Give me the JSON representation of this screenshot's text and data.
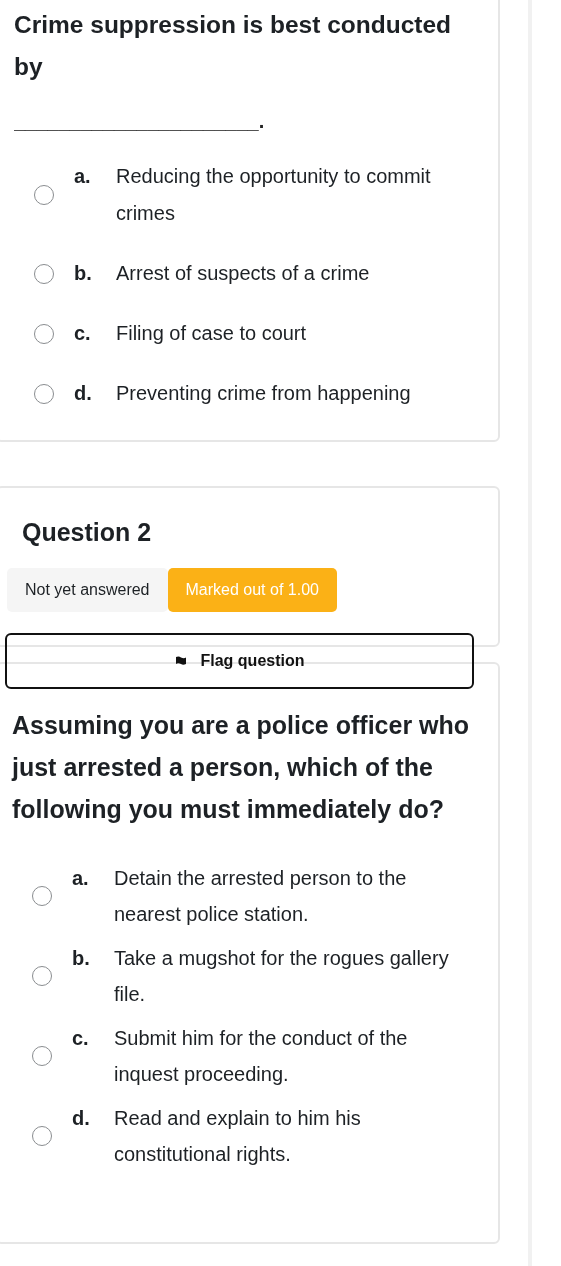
{
  "question_1": {
    "text": "Crime suppression is best conducted by",
    "blank": "______________________.",
    "options": [
      {
        "letter": "a.",
        "text": "Reducing the opportunity to commit crimes",
        "selected": false
      },
      {
        "letter": "b.",
        "text": "Arrest of suspects of a crime",
        "selected": false
      },
      {
        "letter": "c.",
        "text": "Filing of case to court",
        "selected": false
      },
      {
        "letter": "d.",
        "text": "Preventing crime from happening",
        "selected": false
      }
    ]
  },
  "question_2": {
    "title": "Question 2",
    "status": "Not yet answered",
    "marks": "Marked out of 1.00",
    "flag_button": "Flag question",
    "text": "Assuming you are a police officer who just arrested a person, which of the following you must immediately do?",
    "options": [
      {
        "letter": "a.",
        "text": "Detain the arrested person to the nearest police station.",
        "selected": false
      },
      {
        "letter": "b.",
        "text": "Take a mugshot for the rogues gallery file.",
        "selected": false
      },
      {
        "letter": "c.",
        "text": "Submit him for the conduct of the inquest proceeding.",
        "selected": false
      },
      {
        "letter": "d.",
        "text": "Read and explain to him his constitutional rights.",
        "selected": false
      }
    ]
  }
}
